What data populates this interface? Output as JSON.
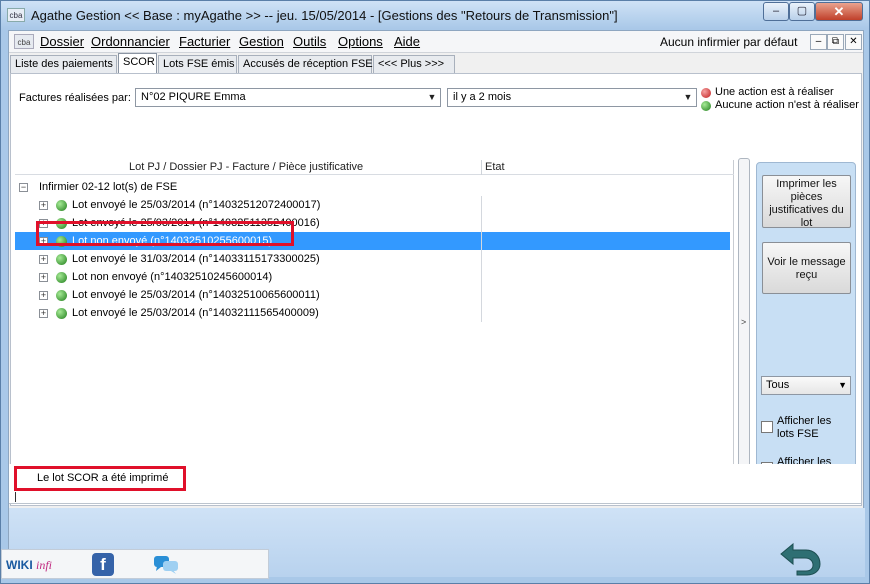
{
  "window": {
    "app_icon_text": "cba",
    "title": "Agathe Gestion << Base : myAgathe >>   --   jeu. 15/05/2014  - [Gestions des \"Retours de Transmission\"]",
    "controls": {
      "minimize": "–",
      "maximize": "▢",
      "close": "✕"
    }
  },
  "menubar": {
    "sys_icon_text": "cba",
    "items": [
      "Dossier",
      "Ordonnancier",
      "Facturier",
      "Gestion",
      "Outils",
      "Options",
      "Aide"
    ],
    "nurse_default": "Aucun infirmier par défaut",
    "sub_controls": {
      "minimize": "–",
      "restore": "⧉",
      "close": "✕"
    }
  },
  "tabs": [
    {
      "label": "Liste des paiements",
      "active": false
    },
    {
      "label": "SCOR",
      "active": true
    },
    {
      "label": "Lots FSE émis",
      "active": false
    },
    {
      "label": "Accusés de réception FSE",
      "active": false
    },
    {
      "label": "<<< Plus >>>",
      "active": false
    }
  ],
  "filters": {
    "invoices_by_label": "Factures réalisées par:",
    "nurse_value": "N°02  PIQURE Emma",
    "period_value": "il y a 2 mois"
  },
  "legend": {
    "action_required": "Une action est à réaliser",
    "no_action": "Aucune action n'est à réaliser"
  },
  "tree": {
    "columns": [
      "Lot PJ / Dossier PJ - Facture / Pièce justificative",
      "Etat"
    ],
    "root": "Infirmier 02-12 lot(s) de FSE",
    "items": [
      {
        "label": "Lot envoyé le 25/03/2014 (n°14032512072400017)",
        "selected": false
      },
      {
        "label": "Lot envoyé le 25/03/2014 (n°14032511352400016)",
        "selected": false
      },
      {
        "label": "Lot non envoyé  (n°14032510255600015)",
        "selected": true
      },
      {
        "label": "Lot envoyé le 31/03/2014 (n°14033115173300025)",
        "selected": false
      },
      {
        "label": "Lot non envoyé  (n°14032510245600014)",
        "selected": false
      },
      {
        "label": "Lot envoyé le 25/03/2014 (n°14032510065600011)",
        "selected": false
      },
      {
        "label": "Lot envoyé le 25/03/2014 (n°14032111565400009)",
        "selected": false
      }
    ],
    "status_color": "#1f7d1a"
  },
  "scroll_arrow": ">",
  "side_panel": {
    "print_button": "Imprimer les pièces justificatives du lot",
    "view_message_button": "Voir le message reçu",
    "type_filter": "Tous",
    "show_lots_fse": "Afficher les lots FSE",
    "show_fse_non_scor": "Afficher les FSE non SCOR"
  },
  "status": {
    "message": "Le lot SCOR a été imprimé"
  },
  "footer": {
    "wiki": "WIKI",
    "wiki_suffix": "infi",
    "facebook_letter": "f"
  },
  "icons": {
    "back": "return-arrow-icon",
    "chat": "chat-icon",
    "facebook": "facebook-icon"
  },
  "colors": {
    "selection": "#3399ff",
    "highlight_frame": "#e0102a",
    "title_bar": "#a9c8e8"
  }
}
